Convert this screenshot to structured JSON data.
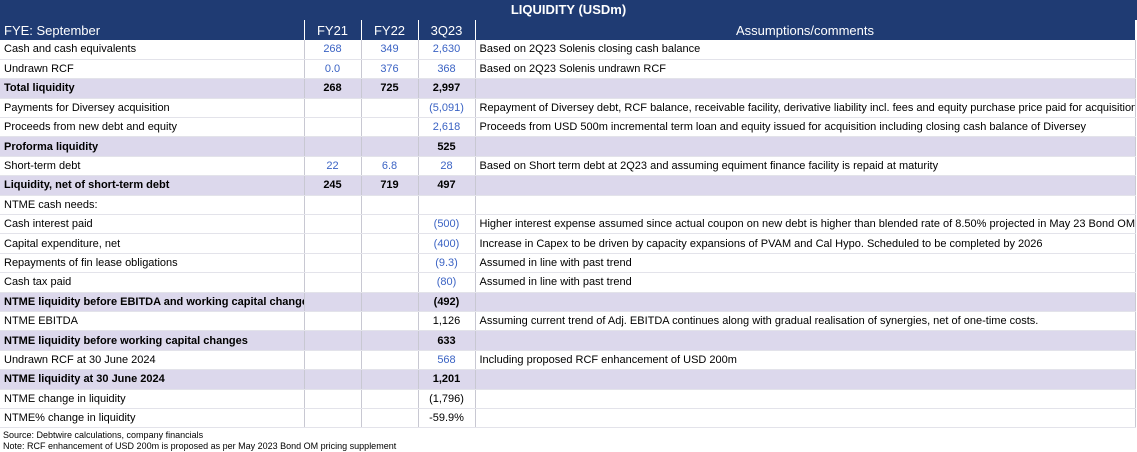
{
  "title": "LIQUIDITY (USDm)",
  "header": {
    "label": "FYE: September",
    "fy21": "FY21",
    "fy22": "FY22",
    "q3": "3Q23",
    "comments": "Assumptions/comments"
  },
  "rows": [
    {
      "label": "Cash and cash equivalents",
      "fy21": "268",
      "fy22": "349",
      "q3": "2,630",
      "comment": "Based on 2Q23 Solenis closing cash balance",
      "style": "blue"
    },
    {
      "label": "Undrawn RCF",
      "fy21": "0.0",
      "fy22": "376",
      "q3": "368",
      "comment": "Based on 2Q23 Solenis undrawn RCF",
      "style": "blue"
    },
    {
      "label": "Total liquidity",
      "fy21": "268",
      "fy22": "725",
      "q3": "2,997",
      "comment": "",
      "style": "bold"
    },
    {
      "label": "Payments for Diversey acquisition",
      "fy21": "",
      "fy22": "",
      "q3": "(5,091)",
      "comment": "Repayment of Diversey debt, RCF balance, receivable facility, derivative liability incl. fees and equity purchase price paid for acquisition",
      "style": "blue"
    },
    {
      "label": "Proceeds from new debt and equity",
      "fy21": "",
      "fy22": "",
      "q3": "2,618",
      "comment": "Proceeds from USD 500m incremental term loan and equity issued for acquisition including closing cash balance of Diversey",
      "style": "blue"
    },
    {
      "label": "Proforma liquidity",
      "fy21": "",
      "fy22": "",
      "q3": "525",
      "comment": "",
      "style": "bold"
    },
    {
      "label": "Short-term debt",
      "fy21": "22",
      "fy22": "6.8",
      "q3": "28",
      "comment": "Based on Short term debt at 2Q23 and assuming equiment finance facility is repaid at maturity",
      "style": "blue"
    },
    {
      "label": "Liquidity, net of short-term debt",
      "fy21": "245",
      "fy22": "719",
      "q3": "497",
      "comment": "",
      "style": "bold"
    },
    {
      "label": "NTME cash needs:",
      "fy21": "",
      "fy22": "",
      "q3": "",
      "comment": "",
      "style": "plain"
    },
    {
      "label": "Cash interest paid",
      "fy21": "",
      "fy22": "",
      "q3": "(500)",
      "comment": "Higher interest expense assumed since actual coupon on new debt is higher than blended rate of 8.50% projected in May 23 Bond OM",
      "style": "blue"
    },
    {
      "label": "Capital expenditure, net",
      "fy21": "",
      "fy22": "",
      "q3": "(400)",
      "comment": "Increase in Capex to be driven by capacity expansions of PVAM and Cal Hypo. Scheduled to be completed by 2026",
      "style": "blue"
    },
    {
      "label": "Repayments of fin lease obligations",
      "fy21": "",
      "fy22": "",
      "q3": "(9.3)",
      "comment": "Assumed in line with past trend",
      "style": "blue"
    },
    {
      "label": "Cash tax paid",
      "fy21": "",
      "fy22": "",
      "q3": "(80)",
      "comment": "Assumed in line with past trend",
      "style": "blue"
    },
    {
      "label": "NTME liquidity before EBITDA and working capital changes",
      "fy21": "",
      "fy22": "",
      "q3": "(492)",
      "comment": "",
      "style": "bold"
    },
    {
      "label": "NTME EBITDA",
      "fy21": "",
      "fy22": "",
      "q3": "1,126",
      "comment": "Assuming current trend of Adj. EBITDA continues along with gradual realisation of synergies, net of one-time costs.",
      "style": "plain"
    },
    {
      "label": "NTME liquidity before working capital changes",
      "fy21": "",
      "fy22": "",
      "q3": "633",
      "comment": "",
      "style": "bold"
    },
    {
      "label": "Undrawn RCF at 30 June 2024",
      "fy21": "",
      "fy22": "",
      "q3": "568",
      "comment": "Including proposed RCF enhancement of USD 200m",
      "style": "blue"
    },
    {
      "label": "NTME liquidity at 30 June 2024",
      "fy21": "",
      "fy22": "",
      "q3": "1,201",
      "comment": "",
      "style": "bold"
    },
    {
      "label": "NTME change in liquidity",
      "fy21": "",
      "fy22": "",
      "q3": "(1,796)",
      "comment": "",
      "style": "plain"
    },
    {
      "label": "NTME% change in liquidity",
      "fy21": "",
      "fy22": "",
      "q3": "-59.9%",
      "comment": "",
      "style": "plain"
    }
  ],
  "notes": {
    "source": "Source: Debtwire calculations, company financials",
    "note": "Note: RCF enhancement of USD 200m is proposed as per May 2023 Bond OM pricing supplement"
  },
  "colors": {
    "header_bg": "#1f3b73",
    "total_row_bg": "#dcd8ec",
    "input_blue": "#3b63c4"
  }
}
